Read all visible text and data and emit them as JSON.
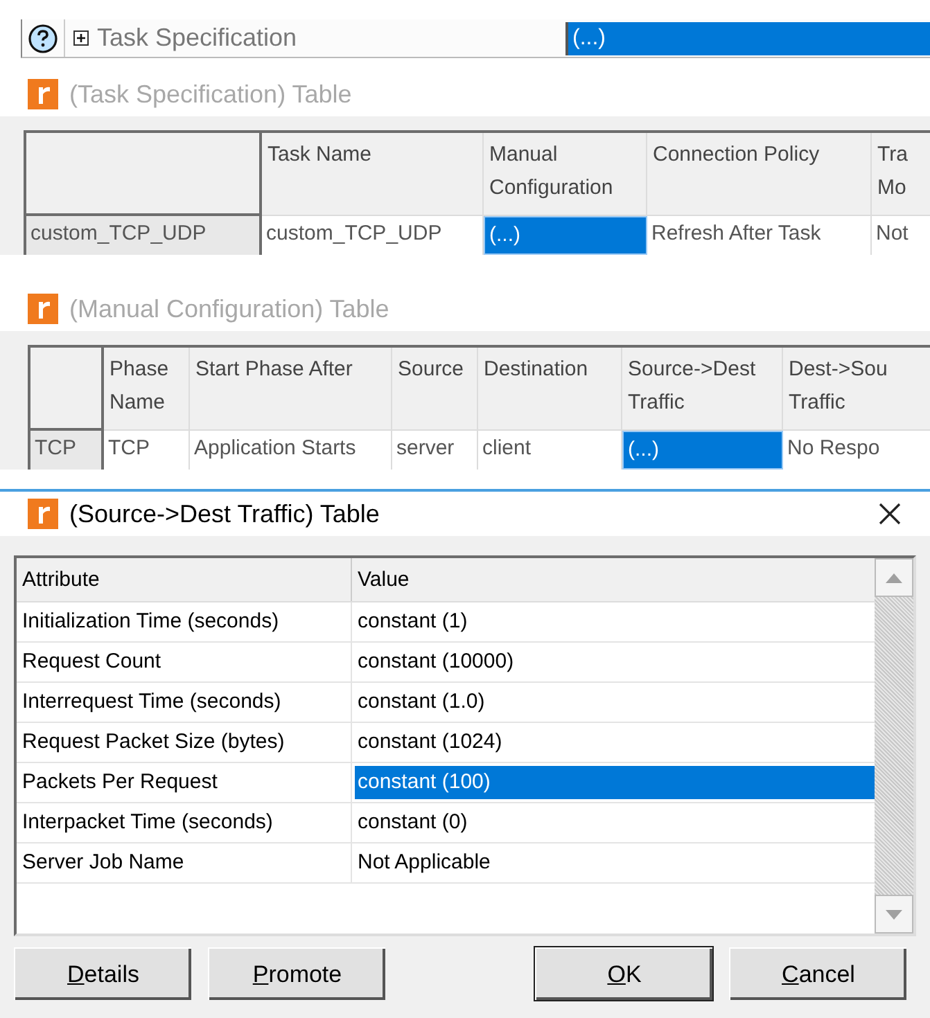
{
  "property_row": {
    "label": "Task Specification",
    "expanded": false,
    "value": "(...)",
    "selected": true
  },
  "background_windows": [
    {
      "title": "(Task Specification) Table",
      "active": false,
      "columns": [
        "",
        "Task Name",
        "Manual Configuration",
        "Connection Policy",
        "Tra Mo"
      ],
      "rows": [
        {
          "cells": [
            {
              "text": "custom_TCP_UDP",
              "selected": false
            },
            {
              "text": "custom_TCP_UDP",
              "selected": false
            },
            {
              "text": "(...)",
              "selected": true
            },
            {
              "text": "Refresh After Task",
              "selected": false
            },
            {
              "text": "Not",
              "selected": false
            }
          ]
        }
      ]
    },
    {
      "title": "(Manual Configuration) Table",
      "active": false,
      "columns": [
        "",
        "Phase Name",
        "Start Phase After",
        "Source",
        "Destination",
        "Source->Dest Traffic",
        "Dest->Sou Traffic"
      ],
      "rows": [
        {
          "cells": [
            {
              "text": "TCP",
              "selected": false
            },
            {
              "text": "TCP",
              "selected": false
            },
            {
              "text": "Application Starts",
              "selected": false
            },
            {
              "text": "server",
              "selected": false
            },
            {
              "text": "client",
              "selected": false
            },
            {
              "text": "(...)",
              "selected": true
            },
            {
              "text": "No Respo",
              "selected": false
            }
          ]
        }
      ]
    }
  ],
  "dialog": {
    "title": "(Source->Dest Traffic) Table",
    "active": true,
    "columns": [
      "Attribute",
      "Value"
    ],
    "rows": [
      {
        "attribute": "Initialization Time (seconds)",
        "value": "constant (1)",
        "selected": false
      },
      {
        "attribute": "Request Count",
        "value": "constant (10000)",
        "selected": false
      },
      {
        "attribute": "Interrequest Time (seconds)",
        "value": "constant (1.0)",
        "selected": false
      },
      {
        "attribute": "Request Packet Size (bytes)",
        "value": "constant (1024)",
        "selected": false
      },
      {
        "attribute": "Packets Per Request",
        "value": "constant (100)",
        "selected": true
      },
      {
        "attribute": "Interpacket Time (seconds)",
        "value": "constant (0)",
        "selected": false
      },
      {
        "attribute": "Server Job Name",
        "value": "Not Applicable",
        "selected": false
      }
    ],
    "buttons": [
      {
        "label": "Details",
        "default": false
      },
      {
        "label": "Promote",
        "default": false
      },
      {
        "label": "OK",
        "default": true
      },
      {
        "label": "Cancel",
        "default": false
      }
    ]
  }
}
